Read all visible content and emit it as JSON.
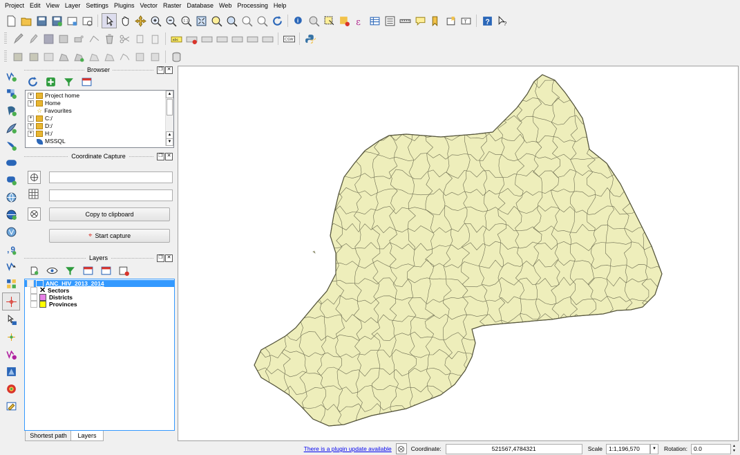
{
  "menu": [
    "Project",
    "Edit",
    "View",
    "Layer",
    "Settings",
    "Plugins",
    "Vector",
    "Raster",
    "Database",
    "Web",
    "Processing",
    "Help"
  ],
  "toolbar_labels": {
    "csw": "CSW",
    "abc": "abc"
  },
  "browser": {
    "title": "Browser",
    "items": [
      {
        "label": "Project home",
        "expandable": true
      },
      {
        "label": "Home",
        "expandable": true
      },
      {
        "label": "Favourites",
        "expandable": false
      },
      {
        "label": "C:/",
        "expandable": true
      },
      {
        "label": "D:/",
        "expandable": true
      },
      {
        "label": "H:/",
        "expandable": true
      },
      {
        "label": "MSSQL",
        "expandable": false
      }
    ]
  },
  "coordinate_capture": {
    "title": "Coordinate Capture",
    "copy_label": "Copy to clipboard",
    "start_label": "Start capture",
    "field1_value": "",
    "field2_value": ""
  },
  "layers": {
    "title": "Layers",
    "group": "ANC_HIV_2013_2014",
    "items": [
      {
        "label": "Sectors",
        "checked": true,
        "swatch": "#ffffff",
        "cross": true
      },
      {
        "label": "Districts",
        "checked": false,
        "swatch": "#e680e6",
        "cross": false
      },
      {
        "label": "Provinces",
        "checked": false,
        "swatch": "#ffff00",
        "cross": false
      }
    ]
  },
  "tabs": [
    "Shortest path",
    "Layers"
  ],
  "status": {
    "plugin_update": "There is a plugin update available",
    "coordinate_label": "Coordinate:",
    "coordinate_value": "521567,4784321",
    "scale_label": "Scale",
    "scale_value": "1:1,196,570",
    "rotation_label": "Rotation:",
    "rotation_value": "0.0"
  },
  "colors": {
    "map_fill": "#eeeebb",
    "map_stroke": "#6b6b50",
    "selection": "#3399ff"
  }
}
